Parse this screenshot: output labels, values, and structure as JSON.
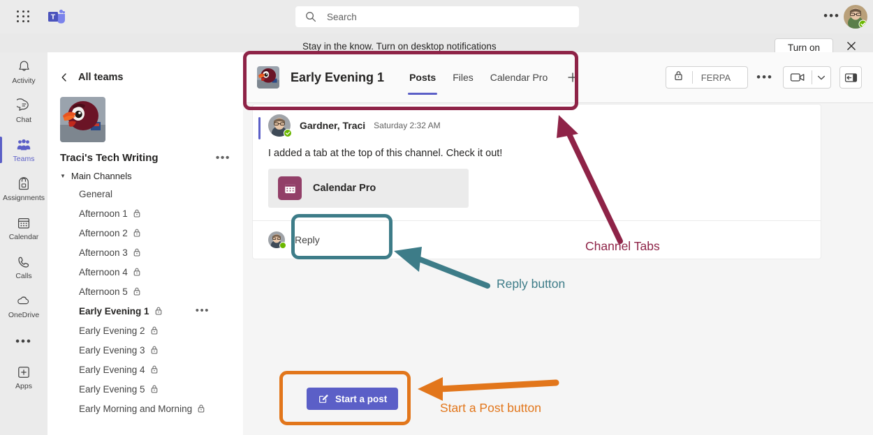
{
  "topbar": {
    "app_grid_icon": "waffle-grid-icon",
    "logo_icon": "teams-logo-icon",
    "search": {
      "icon": "search-icon",
      "placeholder": "Search",
      "value": ""
    },
    "more_label": "•••",
    "avatar": {
      "name": "user-avatar",
      "presence": "available"
    }
  },
  "notification": {
    "message": "Stay in the know. Turn on desktop notifications",
    "turn_on_label": "Turn on",
    "close_icon": "close-icon"
  },
  "rail": {
    "items": [
      {
        "label": "Activity",
        "icon": "bell-icon",
        "active": false
      },
      {
        "label": "Chat",
        "icon": "chat-bubble-icon",
        "active": false
      },
      {
        "label": "Teams",
        "icon": "people-icon",
        "active": true
      },
      {
        "label": "Assignments",
        "icon": "backpack-icon",
        "active": false
      },
      {
        "label": "Calendar",
        "icon": "calendar-icon",
        "active": false
      },
      {
        "label": "Calls",
        "icon": "phone-icon",
        "active": false
      },
      {
        "label": "OneDrive",
        "icon": "cloud-icon",
        "active": false
      }
    ],
    "more_label": "•••",
    "apps": {
      "label": "Apps",
      "icon": "plus-box-icon"
    }
  },
  "sidebar": {
    "back_label": "All teams",
    "back_icon": "chevron-left-icon",
    "team_name": "Traci's Tech Writing",
    "team_avatar_name": "team-avatar-hokiebird",
    "team_more_label": "•••",
    "group_label": "Main Channels",
    "group_arrow_icon": "chevron-down-icon",
    "channels": [
      {
        "label": "General",
        "private": false,
        "selected": false,
        "more": false
      },
      {
        "label": "Afternoon 1",
        "private": true,
        "selected": false,
        "more": false
      },
      {
        "label": "Afternoon 2",
        "private": true,
        "selected": false,
        "more": false
      },
      {
        "label": "Afternoon 3",
        "private": true,
        "selected": false,
        "more": false
      },
      {
        "label": "Afternoon 4",
        "private": true,
        "selected": false,
        "more": false
      },
      {
        "label": "Afternoon 5",
        "private": true,
        "selected": false,
        "more": false
      },
      {
        "label": "Early Evening 1",
        "private": true,
        "selected": true,
        "more": true
      },
      {
        "label": "Early Evening 2",
        "private": true,
        "selected": false,
        "more": false
      },
      {
        "label": "Early Evening 3",
        "private": true,
        "selected": false,
        "more": false
      },
      {
        "label": "Early Evening 4",
        "private": true,
        "selected": false,
        "more": false
      },
      {
        "label": "Early Evening 5",
        "private": true,
        "selected": false,
        "more": false
      },
      {
        "label": "Early Morning and Morning",
        "private": true,
        "selected": false,
        "more": false
      }
    ],
    "channel_more_label": "•••"
  },
  "channel_header": {
    "avatar_name": "channel-avatar-hokiebird",
    "title": "Early Evening 1",
    "tabs": [
      {
        "label": "Posts",
        "active": true
      },
      {
        "label": "Files",
        "active": false
      },
      {
        "label": "Calendar Pro",
        "active": false
      }
    ],
    "add_tab_icon": "plus-icon",
    "ferpa": {
      "lock_icon": "lock-icon",
      "label": "FERPA"
    },
    "more_label": "•••",
    "meet_icon": "video-camera-icon",
    "meet_caret_icon": "chevron-down-icon",
    "panel_icon": "open-panel-icon"
  },
  "message": {
    "author": "Gardner, Traci",
    "timestamp": "Saturday 2:32 AM",
    "avatar_name": "message-author-avatar",
    "presence": "available",
    "text": "I added a tab at the top of this channel. Check it out!",
    "attachment": {
      "icon": "calendar-app-icon",
      "label": "Calendar Pro",
      "color": "#923f68"
    },
    "reply": {
      "label": "Reply",
      "avatar_name": "reply-avatar",
      "presence": "available"
    }
  },
  "compose": {
    "start_post_label": "Start a post",
    "start_post_icon": "compose-pencil-icon",
    "accent_color": "#5b5fc7"
  },
  "annotations": {
    "colors": {
      "maroon": "#8e2347",
      "teal": "#3d7c88",
      "orange": "#e2761b"
    },
    "items": [
      {
        "label": "Channel Tabs",
        "color": "maroon",
        "target": "channel-header"
      },
      {
        "label": "Reply button",
        "color": "teal",
        "target": "reply-row"
      },
      {
        "label": "Start a Post button",
        "color": "orange",
        "target": "start-post-button"
      }
    ]
  }
}
